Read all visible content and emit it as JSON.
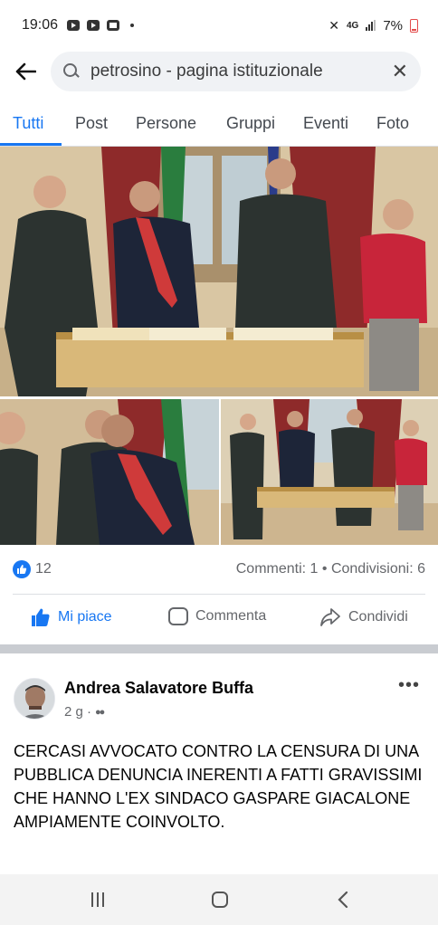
{
  "status_bar": {
    "time": "19:06",
    "network": "4G",
    "battery": "7%"
  },
  "search": {
    "query": "petrosino - pagina istituzionale"
  },
  "tabs": [
    {
      "label": "Tutti",
      "active": true
    },
    {
      "label": "Post",
      "active": false
    },
    {
      "label": "Persone",
      "active": false
    },
    {
      "label": "Gruppi",
      "active": false
    },
    {
      "label": "Eventi",
      "active": false
    },
    {
      "label": "Foto",
      "active": false
    }
  ],
  "post1": {
    "likes": "12",
    "stats": "Commenti: 1 • Condivisioni: 6",
    "actions": {
      "like": "Mi piace",
      "comment": "Commenta",
      "share": "Condividi"
    }
  },
  "post2": {
    "author": "Andrea Salavatore Buffa",
    "time": "2 g ·",
    "text": "CERCASI AVVOCATO CONTRO LA CENSURA DI UNA PUBBLICA DENUNCIA INERENTI A FATTI GRAVISSIMI CHE HANNO L'EX SINDACO GASPARE GIACALONE AMPIAMENTE COINVOLTO."
  },
  "colors": {
    "accent": "#1877f2",
    "text_secondary": "#65676b"
  },
  "icons": [
    "back-arrow-icon",
    "search-icon",
    "clear-icon",
    "like-icon",
    "comment-icon",
    "share-icon",
    "more-icon",
    "friends-icon"
  ]
}
